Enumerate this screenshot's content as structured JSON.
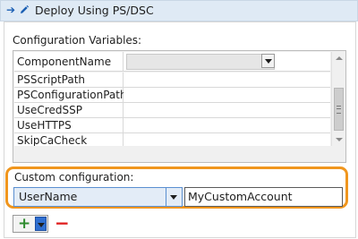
{
  "header": {
    "title": "Deploy Using PS/DSC",
    "arrow_icon": "arrow-right-icon",
    "edit_icon": "pencil-icon"
  },
  "config": {
    "label": "Configuration Variables:",
    "rows": [
      {
        "name": "ComponentName",
        "value": ""
      },
      {
        "name": "PSScriptPath",
        "value": ""
      },
      {
        "name": "PSConfigurationPath",
        "value": ""
      },
      {
        "name": "UseCredSSP",
        "value": ""
      },
      {
        "name": "UseHTTPS",
        "value": ""
      },
      {
        "name": "SkipCaCheck",
        "value": ""
      }
    ]
  },
  "custom": {
    "label": "Custom configuration:",
    "selected_variable": "UserName",
    "value": "MyCustomAccount"
  },
  "actions": {
    "add_glyph": "+",
    "remove_glyph": "−"
  },
  "colors": {
    "header_bg": "#dfeaf5",
    "highlight": "#f0961e",
    "add_green": "#2e8b2e",
    "remove_red": "#e02020",
    "selection_blue": "#2f6fd1"
  }
}
